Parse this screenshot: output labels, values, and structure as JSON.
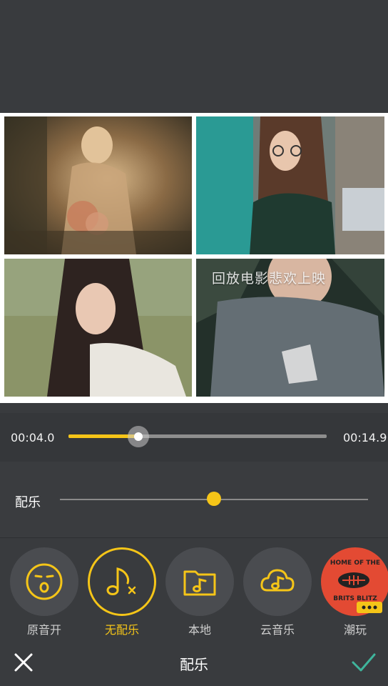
{
  "preview": {
    "overlay_text": "回放电影悲欢上映"
  },
  "timeline": {
    "current_time": "00:04.0",
    "total_time": "00:14.9",
    "progress": 0.27
  },
  "music": {
    "label": "配乐",
    "volume": 0.5
  },
  "options": [
    {
      "label": "原音开",
      "icon": "mouth-face-icon",
      "active": false
    },
    {
      "label": "无配乐",
      "icon": "music-note-off-icon",
      "active": true
    },
    {
      "label": "本地",
      "icon": "folder-music-icon",
      "active": false
    },
    {
      "label": "云音乐",
      "icon": "cloud-music-icon",
      "active": false
    },
    {
      "label": "潮玩",
      "icon": "brits-blitz-badge",
      "active": false
    }
  ],
  "toolbar": {
    "title": "配乐"
  },
  "colors": {
    "accent": "#f5c518",
    "background": "#393b3e",
    "confirm": "#3fb59c"
  }
}
